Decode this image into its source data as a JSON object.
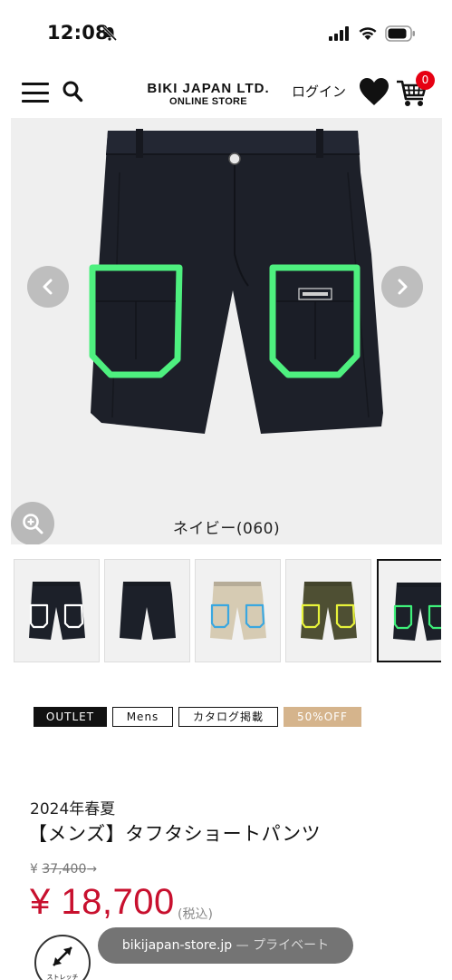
{
  "status_bar": {
    "time": "12:08"
  },
  "header": {
    "brand_main": "BIKI JAPAN LTD.",
    "brand_sub": "ONLINE STORE",
    "login_label": "ログイン",
    "cart_count": "0"
  },
  "product_image": {
    "color_label": "ネイビー(060)"
  },
  "thumbnails": [
    {
      "body_color": "#1c2029",
      "trim_color": "#ffffff",
      "has_pockets": true
    },
    {
      "body_color": "#1c2029",
      "trim_color": "#1c2029",
      "has_pockets": false
    },
    {
      "body_color": "#d6cbb3",
      "trim_color": "#3aa7e0",
      "has_pockets": true
    },
    {
      "body_color": "#4e4f33",
      "trim_color": "#e7f23a",
      "has_pockets": true
    },
    {
      "body_color": "#1c2029",
      "trim_color": "#3ef07a",
      "has_pockets": true
    }
  ],
  "tags": {
    "outlet": "OUTLET",
    "mens": "Mens",
    "catalog": "カタログ掲載",
    "discount": "50%OFF"
  },
  "product": {
    "season": "2024年春夏",
    "title": "【メンズ】タフタショートパンツ",
    "old_price_prefix": "¥ ",
    "old_price": "37,400",
    "old_price_suffix": "→",
    "price": "¥ 18,700",
    "tax_label": "(税込)"
  },
  "stretch_badge": {
    "label": "ストレッチ"
  },
  "url_bar": {
    "domain": "bikijapan-store.jp",
    "mode": " — プライベート"
  },
  "colors": {
    "price_red": "#c8102e",
    "discount_tag": "#d5b48c",
    "accent_green": "#3ef07a",
    "navy": "#1c2029"
  }
}
